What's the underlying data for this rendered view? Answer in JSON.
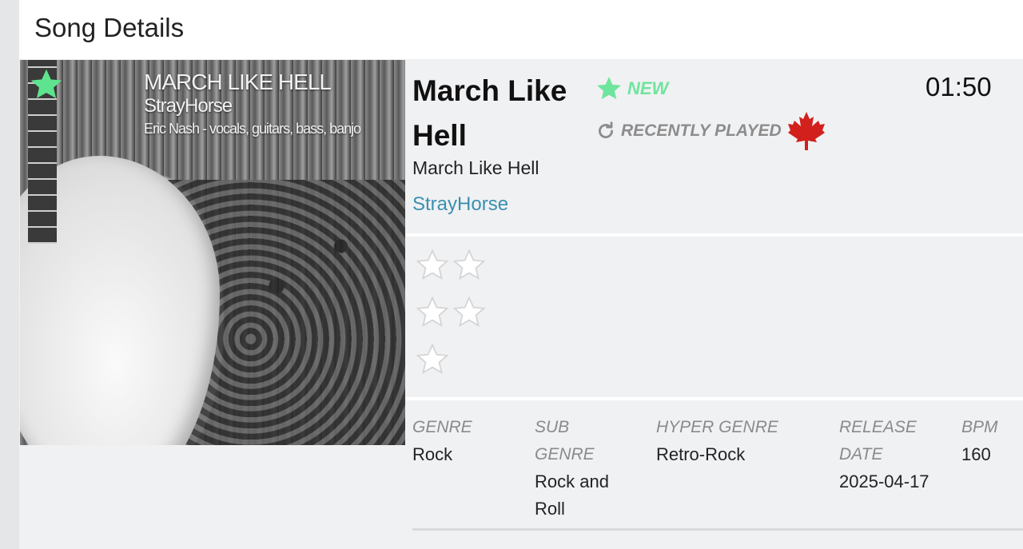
{
  "page": {
    "title": "Song Details"
  },
  "cover": {
    "title_text": "MARCH LIKE HELL",
    "artist_text": "StrayHorse",
    "credits_text": "Eric Nash - vocals, guitars, bass, banjo"
  },
  "song": {
    "title": "March Like Hell",
    "subtitle": "March Like Hell",
    "artist": "StrayHorse",
    "duration": "01:50"
  },
  "badges": {
    "new": "NEW",
    "recently_played": "RECENTLY PLAYED"
  },
  "ratings": {
    "rows": [
      {
        "stars": 2
      },
      {
        "stars": 2
      },
      {
        "stars": 1
      }
    ]
  },
  "meta": {
    "genre": {
      "label": "GENRE",
      "value": "Rock"
    },
    "sub_genre": {
      "label": "SUB GENRE",
      "value": "Rock and Roll"
    },
    "hyper_genre": {
      "label": "HYPER GENRE",
      "value": "Retro-Rock"
    },
    "release_date": {
      "label": "RELEASE DATE",
      "value": "2025-04-17"
    },
    "bpm": {
      "label": "BPM",
      "value": "160"
    }
  },
  "colors": {
    "accent_link": "#3b8fb1",
    "new_badge": "#6ee59c",
    "favorite_star": "#5ee38e",
    "maple_leaf": "#d2201c",
    "recent_badge": "#8c8c8c"
  },
  "icons": {
    "favorite": "star-icon",
    "new": "star-icon",
    "recently_played": "refresh-icon",
    "country": "maple-leaf-icon",
    "rating": "star-outline-icon"
  }
}
